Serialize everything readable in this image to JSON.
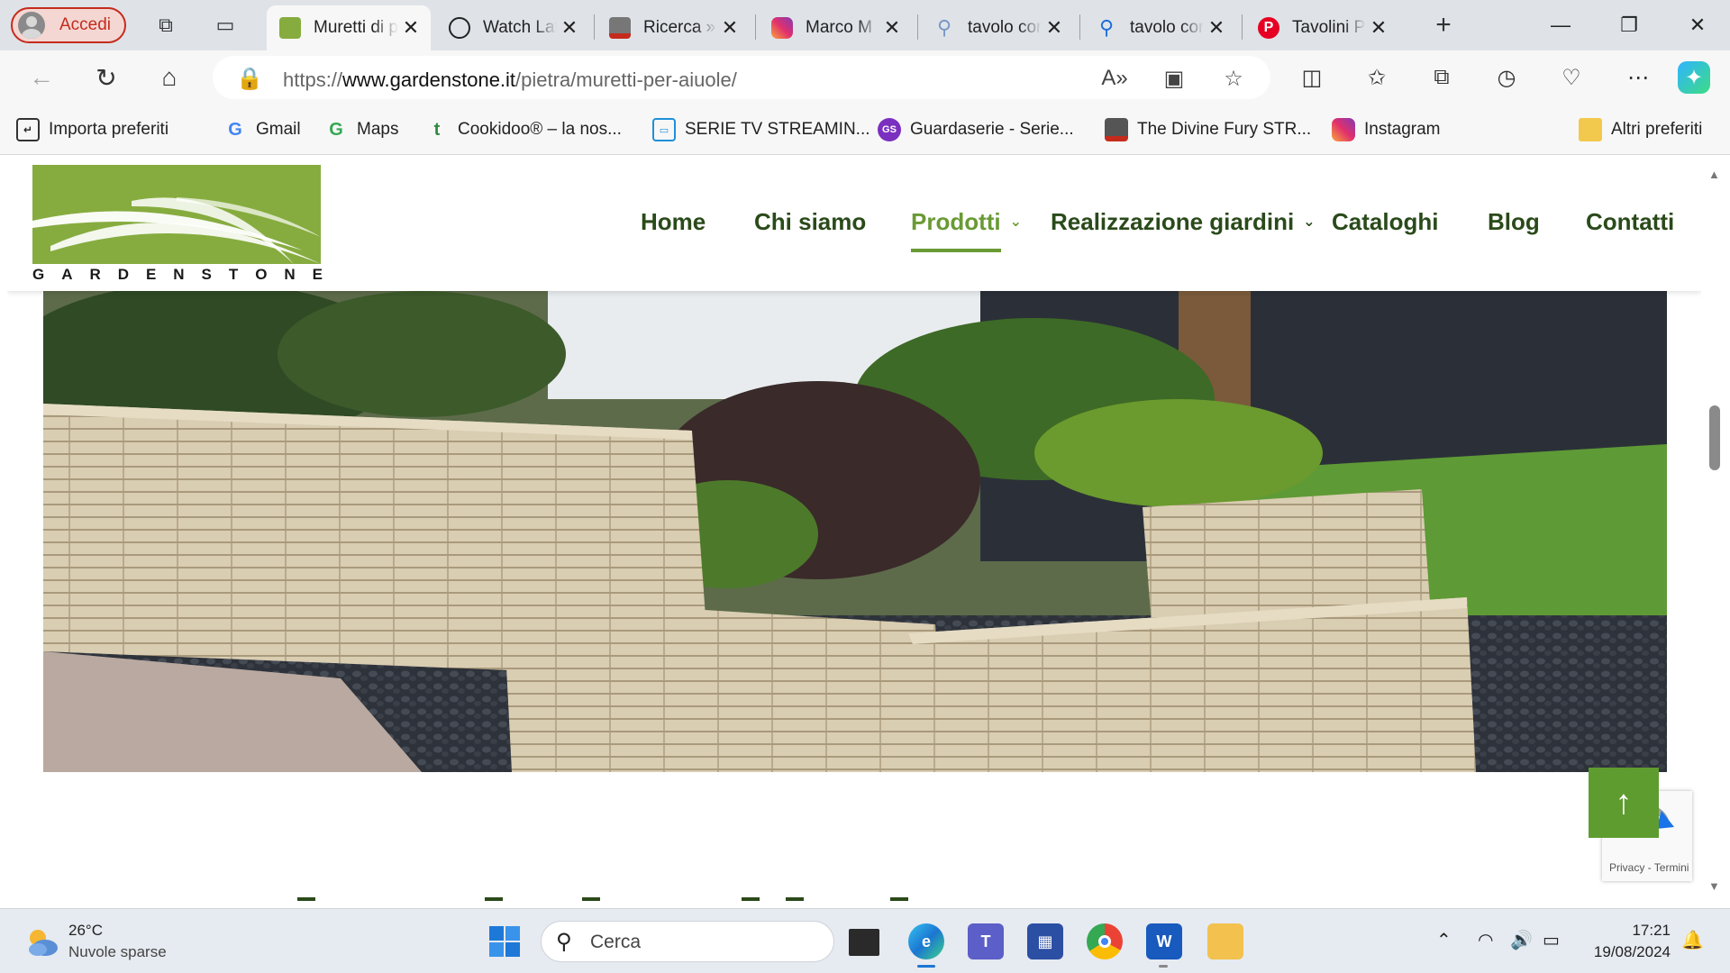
{
  "browser": {
    "profile_label": "Accedi",
    "tabs": [
      {
        "title": "Muretti di pietra per aiuole",
        "active": true
      },
      {
        "title": "Watch Later"
      },
      {
        "title": "Ricerca » The Divine Fury"
      },
      {
        "title": "Marco M"
      },
      {
        "title": "tavolo con sedie"
      },
      {
        "title": "tavolo con sedie"
      },
      {
        "title": "Tavolini Pinterest"
      }
    ],
    "url_prefix": "https://",
    "url_host": "www.gardenstone.it",
    "url_path": "/pietra/muretti-per-aiuole/",
    "bookmarks": [
      {
        "label": "Importa preferiti"
      },
      {
        "label": "Gmail"
      },
      {
        "label": "Maps"
      },
      {
        "label": "Cookidoo® – la nos..."
      },
      {
        "label": "SERIE TV STREAMIN..."
      },
      {
        "label": "Guardaserie - Serie..."
      },
      {
        "label": "The Divine Fury STR..."
      },
      {
        "label": "Instagram"
      }
    ],
    "other_bookmarks": "Altri preferiti"
  },
  "site": {
    "logo_text": "GARDENSTONE",
    "menu": [
      {
        "label": "Home"
      },
      {
        "label": "Chi siamo"
      },
      {
        "label": "Prodotti",
        "active": true,
        "dropdown": true
      },
      {
        "label": "Realizzazione giardini",
        "dropdown": true
      },
      {
        "label": "Cataloghi"
      },
      {
        "label": "Blog"
      },
      {
        "label": "Contatti"
      }
    ],
    "recaptcha_text": "Privacy - Termini",
    "colors": {
      "brand_green": "#86ac3f",
      "menu_text": "#2a4a1a",
      "menu_active": "#6a9a34",
      "button_green": "#5f9c2f"
    }
  },
  "taskbar": {
    "weather_temp": "26°C",
    "weather_desc": "Nuvole sparse",
    "search_placeholder": "Cerca",
    "time": "17:21",
    "date": "19/08/2024"
  }
}
